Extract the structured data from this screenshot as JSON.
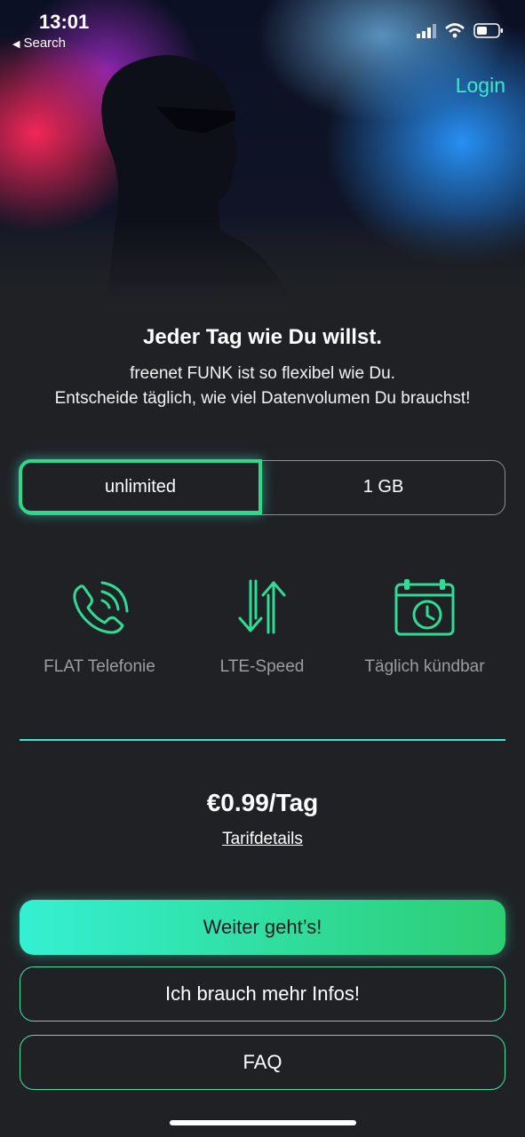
{
  "status_bar": {
    "time": "13:01",
    "back_label": "Search"
  },
  "header": {
    "login_label": "Login"
  },
  "intro": {
    "headline": "Jeder Tag wie Du willst.",
    "subline_1": "freenet FUNK ist so flexibel wie Du.",
    "subline_2": "Entscheide täglich, wie viel Datenvolumen Du brauchst!"
  },
  "plan_selector": {
    "options": [
      "unlimited",
      "1 GB"
    ],
    "selected": "unlimited"
  },
  "features": [
    {
      "icon": "phone-icon",
      "label": "FLAT Telefonie"
    },
    {
      "icon": "data-arrows-icon",
      "label": "LTE-Speed"
    },
    {
      "icon": "calendar-clock-icon",
      "label": "Täglich kündbar"
    }
  ],
  "pricing": {
    "price": "€0.99/Tag",
    "details_link": "Tarifdetails"
  },
  "actions": {
    "primary": "Weiter geht’s!",
    "more_info": "Ich brauch mehr Infos!",
    "faq": "FAQ"
  },
  "colors": {
    "background": "#1f2125",
    "accent": "#3ee8c8",
    "accent_green": "#2dcd72",
    "muted_text": "#9a9da2"
  }
}
